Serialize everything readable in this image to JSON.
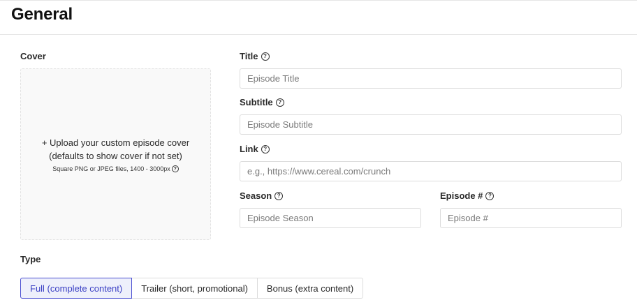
{
  "header": {
    "title": "General"
  },
  "cover": {
    "label": "Cover",
    "upload_line1": "+ Upload your custom episode cover",
    "upload_line2": "(defaults to show cover if not set)",
    "note": "Square PNG or JPEG files, 1400 - 3000px"
  },
  "fields": {
    "title": {
      "label": "Title",
      "placeholder": "Episode Title"
    },
    "subtitle": {
      "label": "Subtitle",
      "placeholder": "Episode Subtitle"
    },
    "link": {
      "label": "Link",
      "placeholder": "e.g., https://www.cereal.com/crunch"
    },
    "season": {
      "label": "Season",
      "placeholder": "Episode Season"
    },
    "episode": {
      "label": "Episode #",
      "placeholder": "Episode #"
    }
  },
  "type": {
    "label": "Type",
    "options": [
      {
        "label": "Full (complete content)",
        "selected": true
      },
      {
        "label": "Trailer (short, promotional)",
        "selected": false
      },
      {
        "label": "Bonus (extra content)",
        "selected": false
      }
    ]
  },
  "icons": {
    "help": "question-circle-icon"
  },
  "colors": {
    "accent": "#4a4fd1",
    "accent_bg": "#eef0fb"
  }
}
